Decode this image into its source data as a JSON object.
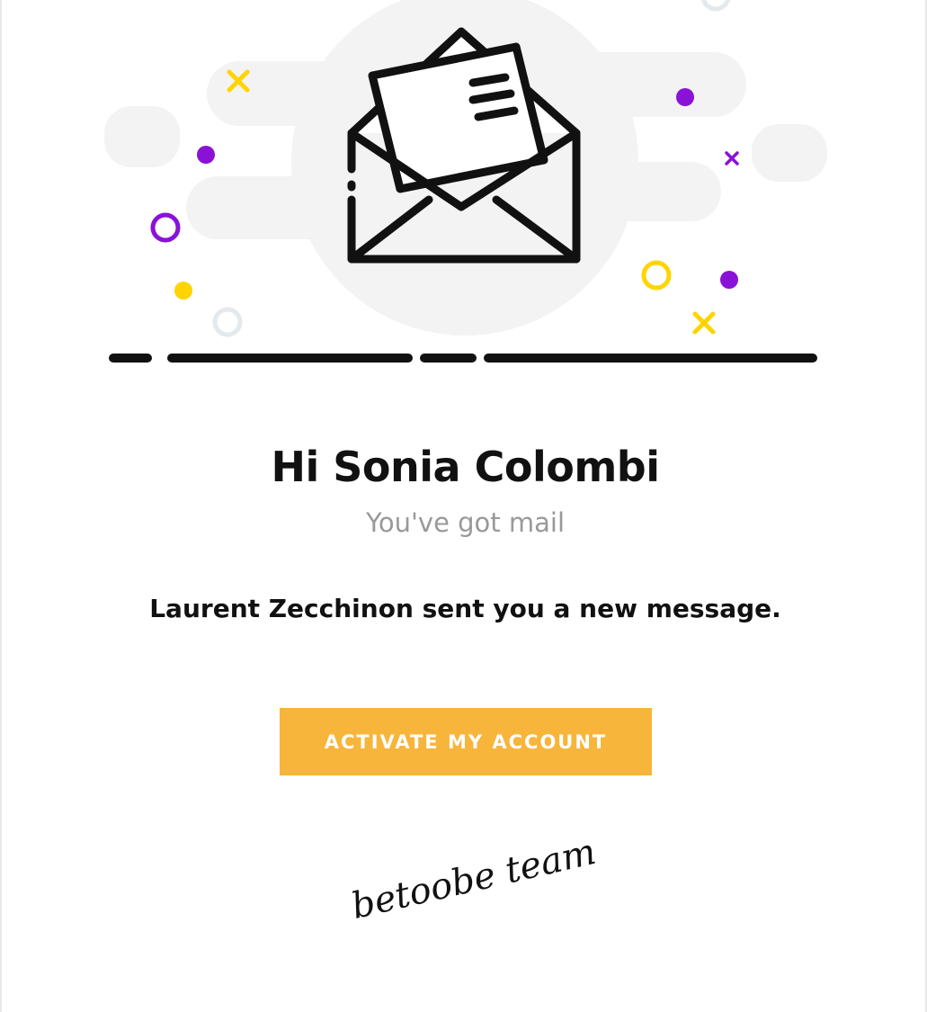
{
  "email": {
    "greeting": "Hi Sonia Colombi",
    "subtitle": "You've got mail",
    "notice": "Laurent Zecchinon sent you a new message.",
    "cta_label": "ACTIVATE MY ACCOUNT",
    "signature": "betoobe team"
  },
  "illustration": {
    "icon": "open-envelope-icon",
    "confetti_icons": [
      "cross-icon",
      "dot-icon",
      "ring-icon"
    ]
  },
  "colors": {
    "accent": "#f7b53b",
    "purple": "#8a12d6",
    "yellow": "#ffd400",
    "cloud": "#f3f3f4",
    "ring_gray": "#e4e9ee",
    "ink": "#111111",
    "muted": "#999999"
  }
}
